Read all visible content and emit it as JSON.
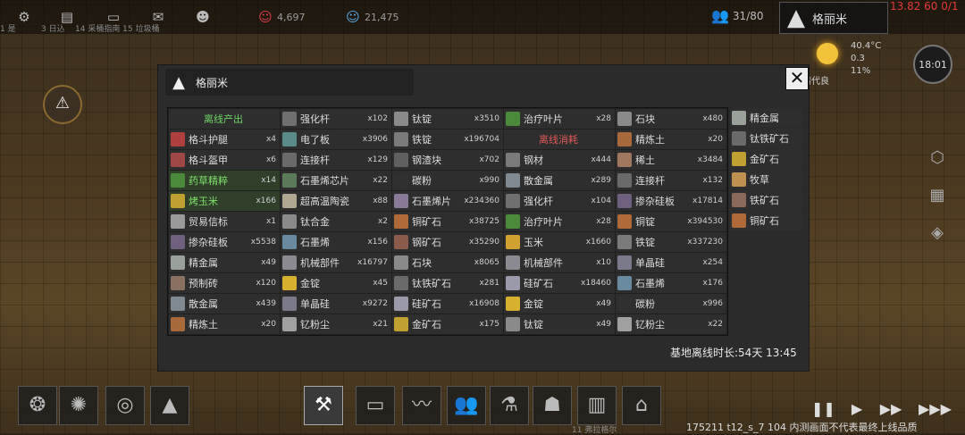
{
  "topbar": {
    "res1_value": "4,697",
    "res2_value": "21,475",
    "sub1": "1 是",
    "sub2": "3 日込",
    "sub3": "14 采桶指南 15 垃圾桶",
    "population": "31/80",
    "colony_name": "格丽米",
    "top_right_numbers": "13.82 60 0/1",
    "weather_temp": "40.4°C",
    "weather_wind": "0.3",
    "weather_humidity": "11%",
    "weather_label": "晴代良",
    "clock": "18:01"
  },
  "dialog": {
    "colony_name": "格丽米",
    "offline_duration": "基地离线时长:54天 13:45",
    "columns": [
      [
        {
          "type": "head",
          "label": "离线产出",
          "color": "g"
        },
        {
          "label": "格斗护腿",
          "qty": "x4",
          "icon": "#b04040"
        },
        {
          "label": "格斗盔甲",
          "qty": "x6",
          "icon": "#a04848"
        },
        {
          "label": "药草精粹",
          "qty": "x14",
          "icon": "#4a8a3a",
          "hl": true
        },
        {
          "label": "烤玉米",
          "qty": "x166",
          "icon": "#c0a030",
          "hl": true
        },
        {
          "label": "贸易信标",
          "qty": "x1",
          "icon": "#9a9a9a"
        },
        {
          "label": "掺杂硅板",
          "qty": "x5538",
          "icon": "#706080"
        },
        {
          "label": "精金属",
          "qty": "x49",
          "icon": "#9aa09a"
        },
        {
          "label": "预制砖",
          "qty": "x120",
          "icon": "#8a7060"
        },
        {
          "label": "散金属",
          "qty": "x439",
          "icon": "#808890"
        },
        {
          "label": "精炼土",
          "qty": "x20",
          "icon": "#a86a3a"
        }
      ],
      [
        {
          "label": "强化杆",
          "qty": "x102",
          "icon": "#707070"
        },
        {
          "label": "电了板",
          "qty": "x3906",
          "icon": "#5a8a8a"
        },
        {
          "label": "连接杆",
          "qty": "x129",
          "icon": "#6a6a6a"
        },
        {
          "label": "石墨烯芯片",
          "qty": "x22",
          "icon": "#5a7a5a"
        },
        {
          "label": "超高温陶瓷",
          "qty": "x88",
          "icon": "#b0a890"
        },
        {
          "label": "钛合金",
          "qty": "x2",
          "icon": "#8a8a8a"
        },
        {
          "label": "石墨烯",
          "qty": "x156",
          "icon": "#6a8aa0"
        },
        {
          "label": "机械部件",
          "qty": "x16797",
          "icon": "#8a8a90"
        },
        {
          "label": "金锭",
          "qty": "x45",
          "icon": "#d8b030"
        },
        {
          "label": "单晶硅",
          "qty": "x9272",
          "icon": "#7a7a8a"
        },
        {
          "label": "钇粉尘",
          "qty": "x21",
          "icon": "#a0a0a0"
        }
      ],
      [
        {
          "label": "钛锭",
          "qty": "x3510",
          "icon": "#8a8a8a"
        },
        {
          "label": "铁锭",
          "qty": "x196704",
          "icon": "#7a7a7a"
        },
        {
          "label": "钢渣块",
          "qty": "x702",
          "icon": "#606060"
        },
        {
          "label": "碳粉",
          "qty": "x990",
          "icon": "#303030"
        },
        {
          "label": "石墨烯片",
          "qty": "x234360",
          "icon": "#8a7a9a"
        },
        {
          "label": "铜矿石",
          "qty": "x38725",
          "icon": "#b06a3a"
        },
        {
          "label": "钢矿石",
          "qty": "x35290",
          "icon": "#8a5a4a"
        },
        {
          "label": "石块",
          "qty": "x8065",
          "icon": "#8a8a8a"
        },
        {
          "label": "钛铁矿石",
          "qty": "x281",
          "icon": "#6a6a6a"
        },
        {
          "label": "硅矿石",
          "qty": "x16908",
          "icon": "#9a9aaa"
        },
        {
          "label": "金矿石",
          "qty": "x175",
          "icon": "#c0a030"
        }
      ],
      [
        {
          "label": "治疗叶片",
          "qty": "x28",
          "icon": "#4a8a3a"
        },
        {
          "type": "head",
          "label": "离线消耗",
          "color": "r"
        },
        {
          "label": "钢材",
          "qty": "x444",
          "icon": "#7a7a7a"
        },
        {
          "label": "散金属",
          "qty": "x289",
          "icon": "#808890"
        },
        {
          "label": "强化杆",
          "qty": "x104",
          "icon": "#707070"
        },
        {
          "label": "治疗叶片",
          "qty": "x28",
          "icon": "#4a8a3a"
        },
        {
          "label": "玉米",
          "qty": "x1660",
          "icon": "#d0a030"
        },
        {
          "label": "机械部件",
          "qty": "x10",
          "icon": "#8a8a90"
        },
        {
          "label": "硅矿石",
          "qty": "x18460",
          "icon": "#9a9aaa"
        },
        {
          "label": "金锭",
          "qty": "x49",
          "icon": "#d8b030"
        },
        {
          "label": "钛锭",
          "qty": "x49",
          "icon": "#8a8a8a"
        }
      ],
      [
        {
          "label": "石块",
          "qty": "x480",
          "icon": "#8a8a8a"
        },
        {
          "label": "精炼土",
          "qty": "x20",
          "icon": "#a86a3a"
        },
        {
          "label": "稀土",
          "qty": "x3484",
          "icon": "#a07860"
        },
        {
          "label": "连接杆",
          "qty": "x132",
          "icon": "#6a6a6a"
        },
        {
          "label": "掺杂硅板",
          "qty": "x17814",
          "icon": "#706080"
        },
        {
          "label": "铜锭",
          "qty": "x394530",
          "icon": "#b06a3a"
        },
        {
          "label": "铁锭",
          "qty": "x337230",
          "icon": "#7a7a7a"
        },
        {
          "label": "单晶硅",
          "qty": "x254",
          "icon": "#7a7a8a"
        },
        {
          "label": "石墨烯",
          "qty": "x176",
          "icon": "#6a8aa0"
        },
        {
          "label": "碳粉",
          "qty": "x996",
          "icon": "#303030"
        },
        {
          "label": "钇粉尘",
          "qty": "x22",
          "icon": "#a0a0a0"
        }
      ],
      [
        {
          "label": "精金属",
          "qty": "",
          "icon": "#9aa09a"
        },
        {
          "label": "钛铁矿石",
          "qty": "",
          "icon": "#6a6a6a"
        },
        {
          "label": "金矿石",
          "qty": "",
          "icon": "#c0a030"
        },
        {
          "label": "牧草",
          "qty": "",
          "icon": "#c09050"
        },
        {
          "label": "铁矿石",
          "qty": "",
          "icon": "#8a6a5a"
        },
        {
          "label": "铜矿石",
          "qty": "",
          "icon": "#b06a3a"
        }
      ]
    ]
  },
  "build_info": "175211 t12_s_7 104  内测画面不代表最终上线品质",
  "bottom_label": "11 弗拉格尔"
}
